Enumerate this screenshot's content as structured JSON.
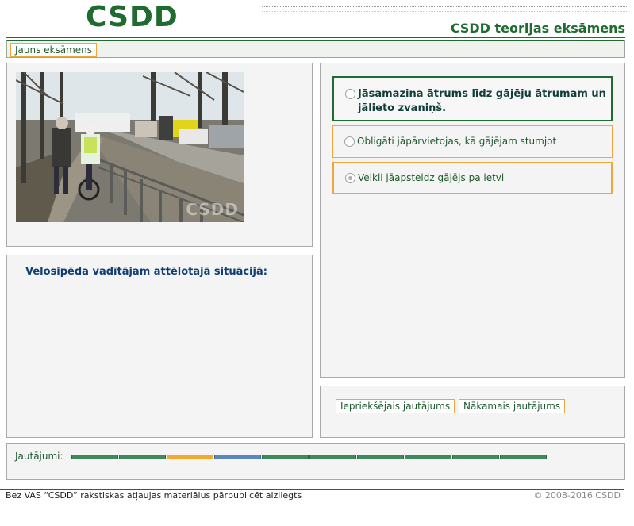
{
  "header": {
    "logo_text": "CSDD",
    "app_title": "CSDD teorijas eksāmens"
  },
  "toolbar": {
    "new_exam_label": "Jauns eksāmens"
  },
  "image": {
    "watermark": "CSDD"
  },
  "question": {
    "text": "Velosipēda vadītājam attēlotajā situācijā:"
  },
  "answers": [
    {
      "text": "Jāsamazina ātrums līdz gājēju ātrumam un jālieto zvaniņš.",
      "state": "selected"
    },
    {
      "text": "Obligāti jāpārvietojas, kā gājējam stumjot velosipēdu",
      "state": "normal"
    },
    {
      "text": "Veikli jāapsteidz gājējs pa ietvi",
      "state": "disabled"
    }
  ],
  "navigation": {
    "prev_label": "Iepriekšējais jautājums",
    "next_label": "Nākamais jautājums"
  },
  "progress": {
    "label": "Jautājumi:",
    "segments": [
      "done",
      "done",
      "current",
      "active",
      "done",
      "done",
      "done",
      "done",
      "done",
      "done"
    ]
  },
  "footer": {
    "notice": "Bez VAS “CSDD” rakstiskas atļaujas materiālus pārpublicēt aizliegts",
    "copyright": "© 2008-2016 CSDD"
  },
  "colors": {
    "brand_green": "#1f6b30",
    "accent_orange": "#f0a63a",
    "question_blue": "#123e73",
    "progress_done": "#3f8a5a",
    "progress_current": "#f2aa2e",
    "progress_active": "#5a87bf"
  }
}
